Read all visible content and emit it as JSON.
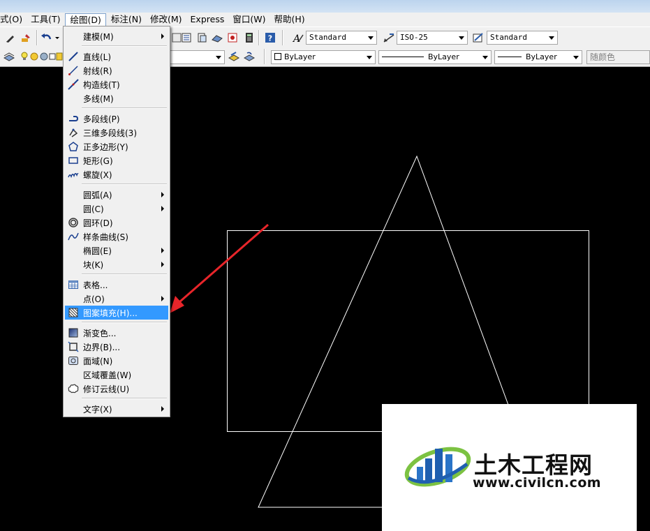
{
  "menubar": {
    "items": [
      {
        "label": "式(O)"
      },
      {
        "label": "工具(T)"
      },
      {
        "label": "绘图(D)"
      },
      {
        "label": "标注(N)"
      },
      {
        "label": "修改(M)"
      },
      {
        "label": "Express"
      },
      {
        "label": "窗口(W)"
      },
      {
        "label": "帮助(H)"
      }
    ],
    "active_index": 2
  },
  "toolbar": {
    "text_style": "Standard",
    "dim_style": "ISO-25",
    "table_style": "Standard",
    "color": "ByLayer",
    "linetype": "ByLayer",
    "lineweight": "ByLayer",
    "plot_style": "随颜色"
  },
  "draw_menu": {
    "items": [
      {
        "label": "建模(M)",
        "icon": "none",
        "submenu": true
      },
      {
        "label": "直线(L)",
        "icon": "line-icon"
      },
      {
        "label": "射线(R)",
        "icon": "ray-icon"
      },
      {
        "label": "构造线(T)",
        "icon": "xline-icon"
      },
      {
        "label": "多线(M)",
        "icon": "none"
      },
      {
        "label": "多段线(P)",
        "icon": "polyline-icon"
      },
      {
        "label": "三维多段线(3)",
        "icon": "3dpoly-icon"
      },
      {
        "label": "正多边形(Y)",
        "icon": "polygon-icon"
      },
      {
        "label": "矩形(G)",
        "icon": "rectangle-icon"
      },
      {
        "label": "螺旋(X)",
        "icon": "helix-icon"
      },
      {
        "label": "圆弧(A)",
        "icon": "none",
        "submenu": true
      },
      {
        "label": "圆(C)",
        "icon": "none",
        "submenu": true
      },
      {
        "label": "圆环(D)",
        "icon": "donut-icon"
      },
      {
        "label": "样条曲线(S)",
        "icon": "spline-icon"
      },
      {
        "label": "椭圆(E)",
        "icon": "none",
        "submenu": true
      },
      {
        "label": "块(K)",
        "icon": "none",
        "submenu": true
      },
      {
        "label": "表格...",
        "icon": "table-icon"
      },
      {
        "label": "点(O)",
        "icon": "none",
        "submenu": true
      },
      {
        "label": "图案填充(H)...",
        "icon": "hatch-icon",
        "highlighted": true
      },
      {
        "label": "渐变色...",
        "icon": "gradient-icon"
      },
      {
        "label": "边界(B)...",
        "icon": "boundary-icon"
      },
      {
        "label": "面域(N)",
        "icon": "region-icon"
      },
      {
        "label": "区域覆盖(W)",
        "icon": "none"
      },
      {
        "label": "修订云线(U)",
        "icon": "revcloud-icon"
      },
      {
        "label": "文字(X)",
        "icon": "none",
        "submenu": true
      }
    ]
  },
  "watermark": {
    "title": "土木工程网",
    "url": "www.civilcn.com"
  },
  "colors": {
    "highlight": "#3399ff",
    "menu_bg": "#f0f0f0",
    "canvas_bg": "#000000",
    "arrow": "#e8252a",
    "logo_blue": "#1f5fb0",
    "logo_green": "#7cc242"
  }
}
